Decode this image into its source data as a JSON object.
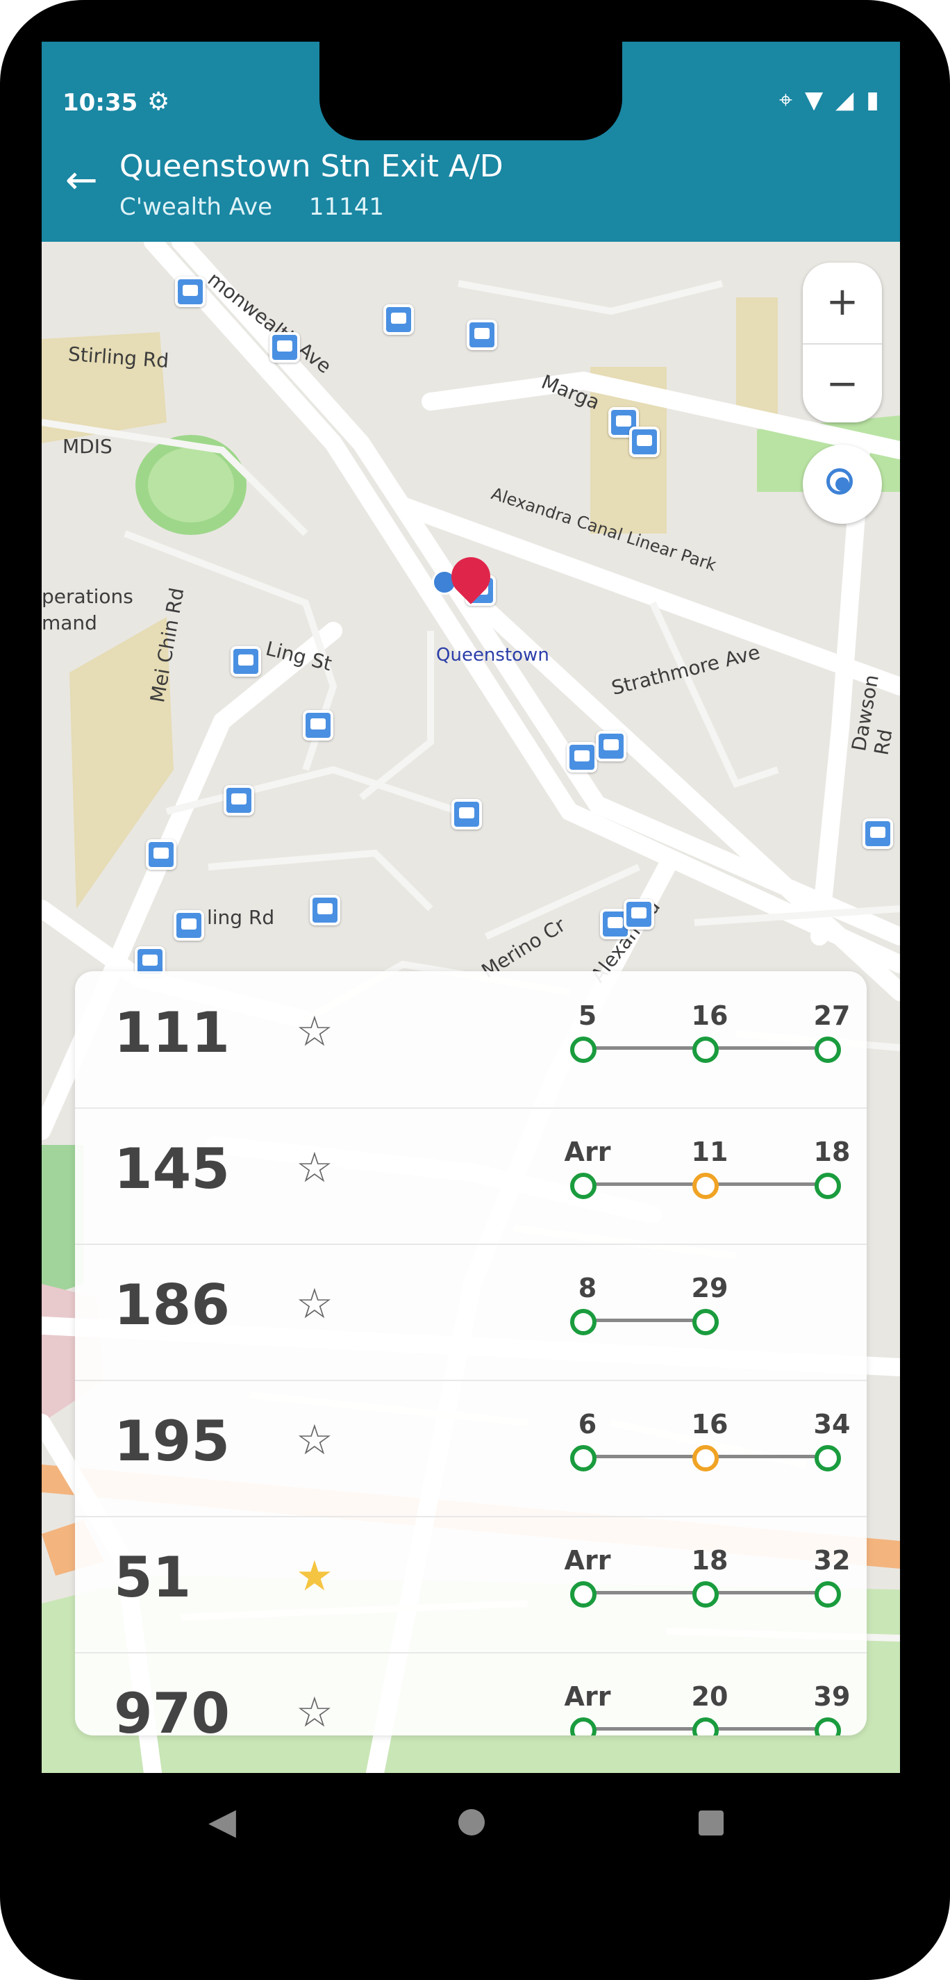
{
  "status": {
    "time": "10:35"
  },
  "header": {
    "title": "Queenstown Stn Exit A/D",
    "road": "C'wealth Ave",
    "stop_code": "11141"
  },
  "map": {
    "labels": {
      "stirling": "Stirling Rd",
      "mdis": "MDIS",
      "commonwealth": "monwealth Ave",
      "margaret": "Marga",
      "alexandra_canal": "Alexandra Canal Linear Park",
      "operations": "perations",
      "mand": "mand",
      "ling_st": "Ling St",
      "queenstown": "Queenstown",
      "strathmore": "Strathmore Ave",
      "mei_chin": "Mei Chin Rd",
      "dawson": "Dawson Rd",
      "ling_rd": "ling Rd",
      "merino": "Merino Cr",
      "alexandra_rd": "Alexan Rd"
    },
    "zoom_in": "+",
    "zoom_out": "−"
  },
  "arrivals": [
    {
      "service": "111",
      "favorite": false,
      "etas": [
        "5",
        "16",
        "27"
      ],
      "load": [
        "green",
        "green",
        "green"
      ]
    },
    {
      "service": "145",
      "favorite": false,
      "etas": [
        "Arr",
        "11",
        "18"
      ],
      "load": [
        "green",
        "orange",
        "green"
      ]
    },
    {
      "service": "186",
      "favorite": false,
      "etas": [
        "8",
        "29"
      ],
      "load": [
        "green",
        "green"
      ]
    },
    {
      "service": "195",
      "favorite": false,
      "etas": [
        "6",
        "16",
        "34"
      ],
      "load": [
        "green",
        "orange",
        "green"
      ]
    },
    {
      "service": "51",
      "favorite": true,
      "etas": [
        "Arr",
        "18",
        "32"
      ],
      "load": [
        "green",
        "green",
        "green"
      ]
    },
    {
      "service": "970",
      "favorite": false,
      "etas": [
        "Arr",
        "20",
        "39"
      ],
      "load": [
        "green",
        "green",
        "green"
      ]
    }
  ],
  "icons": {
    "star": "☆",
    "star_filled": "★",
    "back": "←"
  },
  "colors": {
    "header": "#1a87a3",
    "load_green": "#1a9c3e",
    "load_orange": "#f0a324",
    "favorite": "#f5c542"
  }
}
